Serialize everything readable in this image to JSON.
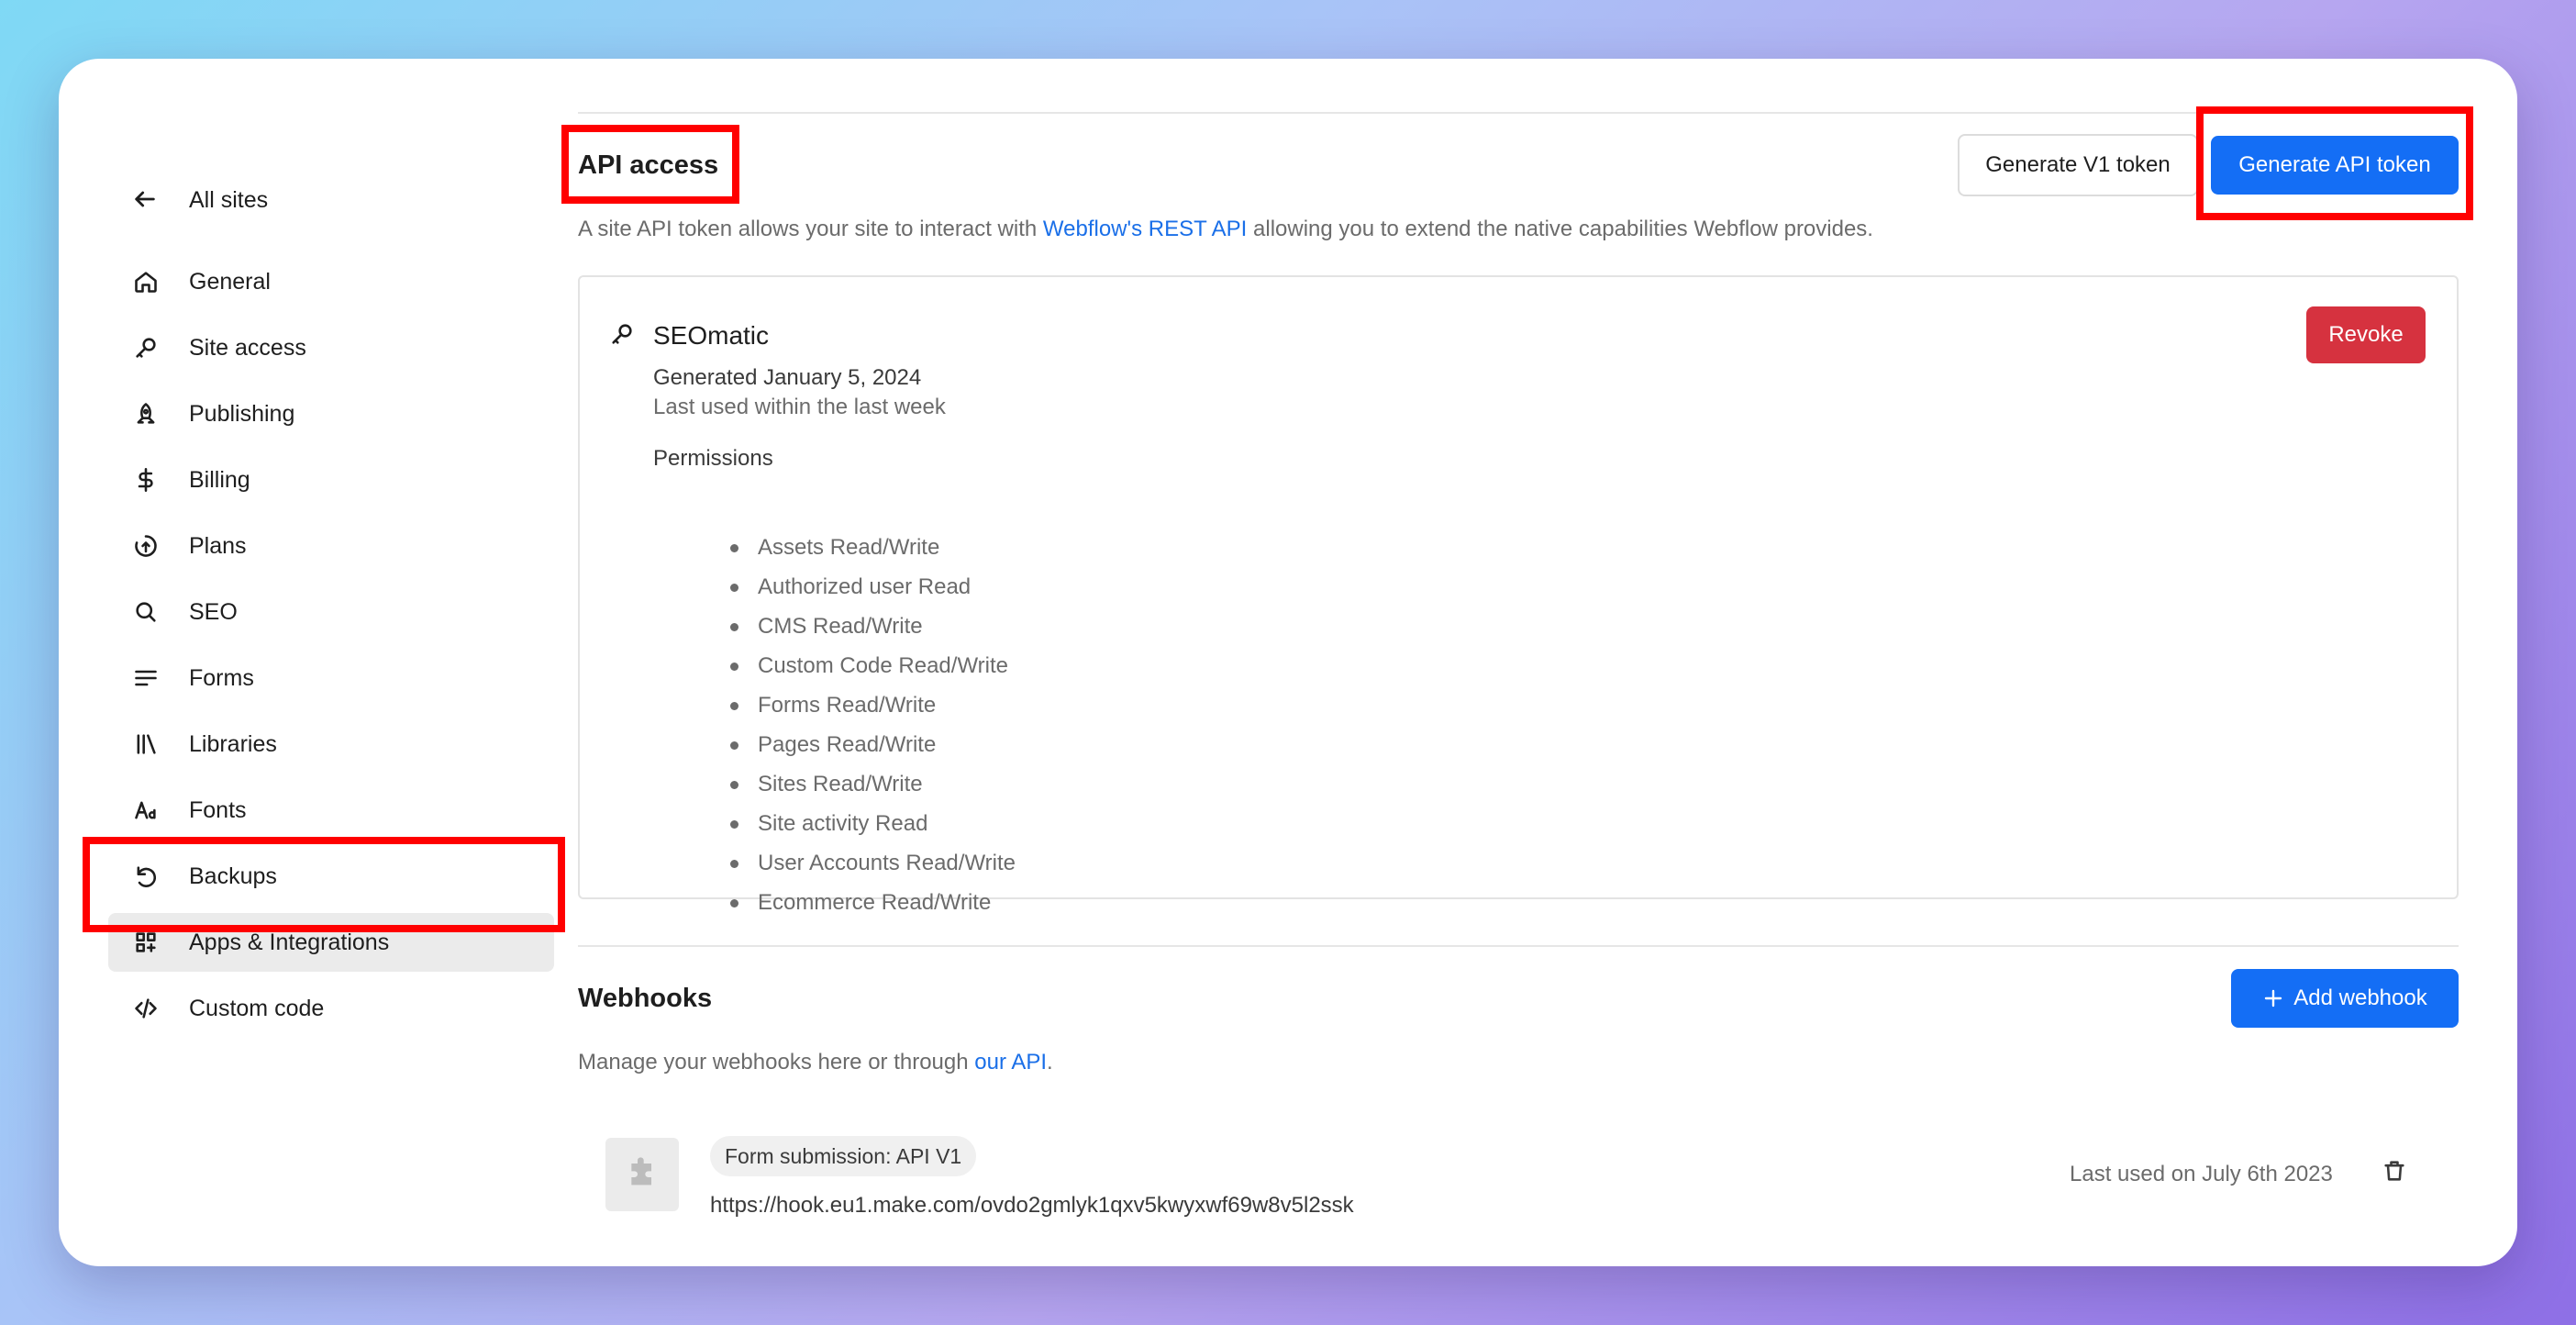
{
  "sidebar": {
    "back_label": "All sites",
    "items": [
      {
        "label": "General",
        "icon": "home-icon"
      },
      {
        "label": "Site access",
        "icon": "key-icon"
      },
      {
        "label": "Publishing",
        "icon": "rocket-icon"
      },
      {
        "label": "Billing",
        "icon": "dollar-icon"
      },
      {
        "label": "Plans",
        "icon": "plans-icon"
      },
      {
        "label": "SEO",
        "icon": "search-icon"
      },
      {
        "label": "Forms",
        "icon": "forms-icon"
      },
      {
        "label": "Libraries",
        "icon": "libraries-icon"
      },
      {
        "label": "Fonts",
        "icon": "fonts-icon"
      },
      {
        "label": "Backups",
        "icon": "backup-icon"
      },
      {
        "label": "Apps & Integrations",
        "icon": "apps-icon",
        "active": true
      },
      {
        "label": "Custom code",
        "icon": "code-icon"
      }
    ]
  },
  "api_access": {
    "title": "API access",
    "generate_v1_label": "Generate V1 token",
    "generate_api_label": "Generate API token",
    "description_prefix": "A site API token allows your site to interact with ",
    "description_link": "Webflow's REST API",
    "description_suffix": " allowing you to extend the native capabilities Webflow provides.",
    "token": {
      "name": "SEOmatic",
      "generated": "Generated January 5, 2024",
      "last_used": "Last used within the last week",
      "permissions_label": "Permissions",
      "permissions": [
        "Assets Read/Write",
        "Authorized user Read",
        "CMS Read/Write",
        "Custom Code Read/Write",
        "Forms Read/Write",
        "Pages Read/Write",
        "Sites Read/Write",
        "Site activity Read",
        "User Accounts Read/Write",
        "Ecommerce Read/Write"
      ],
      "revoke_label": "Revoke"
    }
  },
  "webhooks": {
    "title": "Webhooks",
    "add_label": "Add webhook",
    "description_prefix": "Manage your webhooks here or through ",
    "description_link": "our API",
    "description_suffix": ".",
    "items": [
      {
        "tag": "Form submission: API V1",
        "url": "https://hook.eu1.make.com/ovdo2gmlyk1qxv5kwyxwf69w8v5l2ssk",
        "last_used": "Last used on July 6th 2023"
      }
    ]
  },
  "colors": {
    "primary": "#146ef5",
    "danger": "#d6323f",
    "link": "#1a6fe8",
    "highlight": "#ff0000"
  }
}
